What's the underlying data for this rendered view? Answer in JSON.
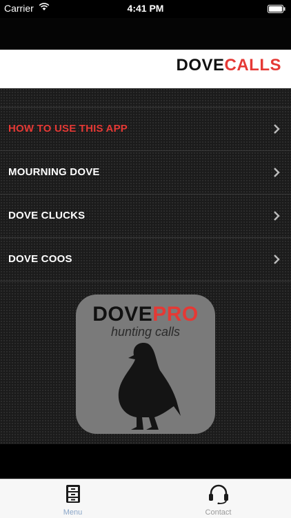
{
  "status_bar": {
    "carrier": "Carrier",
    "time": "4:41 PM"
  },
  "header": {
    "logo_part1": "DOVE",
    "logo_part2": "CALLS"
  },
  "menu": {
    "items": [
      {
        "label": "HOW TO USE THIS APP",
        "active": true
      },
      {
        "label": "MOURNING DOVE"
      },
      {
        "label": "DOVE CLUCKS"
      },
      {
        "label": "DOVE COOS"
      }
    ]
  },
  "app_icon": {
    "brand_part1": "DOVE",
    "brand_part2": "PRO",
    "subtitle": "hunting calls"
  },
  "tabbar": {
    "tabs": [
      {
        "label": "Menu",
        "icon": "cabinet-icon",
        "selected": true
      },
      {
        "label": "Contact",
        "icon": "headset-icon"
      }
    ]
  },
  "colors": {
    "accent_red": "#e53935",
    "menu_bg": "#1b1b1b",
    "icon_bg": "#7a7a7a"
  }
}
